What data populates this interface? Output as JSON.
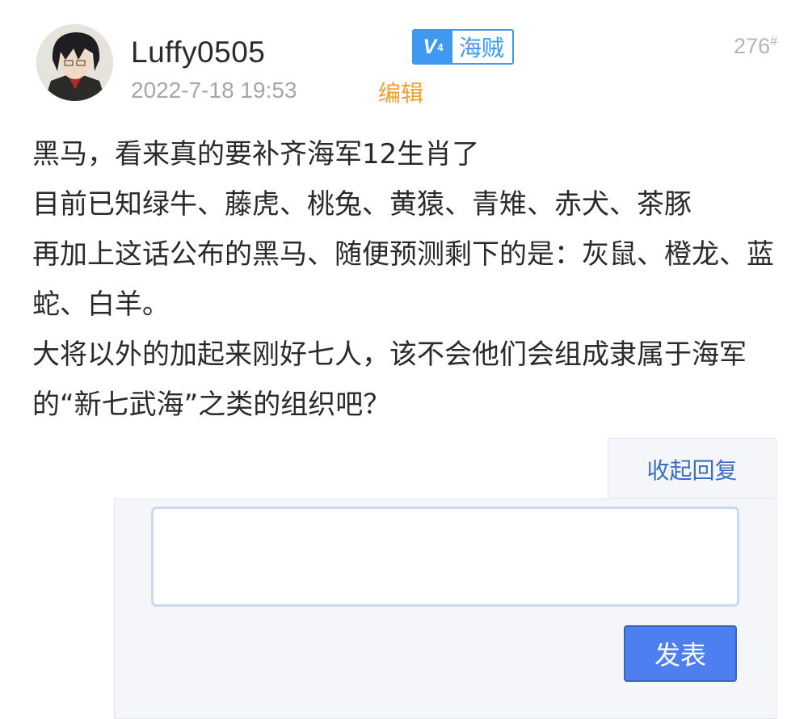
{
  "post": {
    "username": "Luffy0505",
    "badge_icon": "vip-v-icon",
    "badge_level": "4",
    "badge_label": "海贼",
    "floor_number": "276",
    "floor_mark": "#",
    "date": "2022-7-18 19:53",
    "edit_label": "编辑",
    "content_lines": [
      "黑马，看来真的要补齐海军12生肖了",
      "目前已知绿牛、藤虎、桃兔、黄猿、青雉、赤犬、茶豚",
      "再加上这话公布的黑马、随便预测剩下的是：灰鼠、橙龙、蓝蛇、白羊。",
      "大将以外的加起来刚好七人，该不会他们会组成隶属于海军的“新七武海”之类的组织吧？"
    ]
  },
  "reply": {
    "collapse_label": "收起回复",
    "input_value": "",
    "submit_label": "发表"
  },
  "colors": {
    "badge_blue": "#3e9af0",
    "edit_orange": "#f0a030",
    "link_blue": "#3a6fc4",
    "button_blue": "#4d7ff0"
  }
}
